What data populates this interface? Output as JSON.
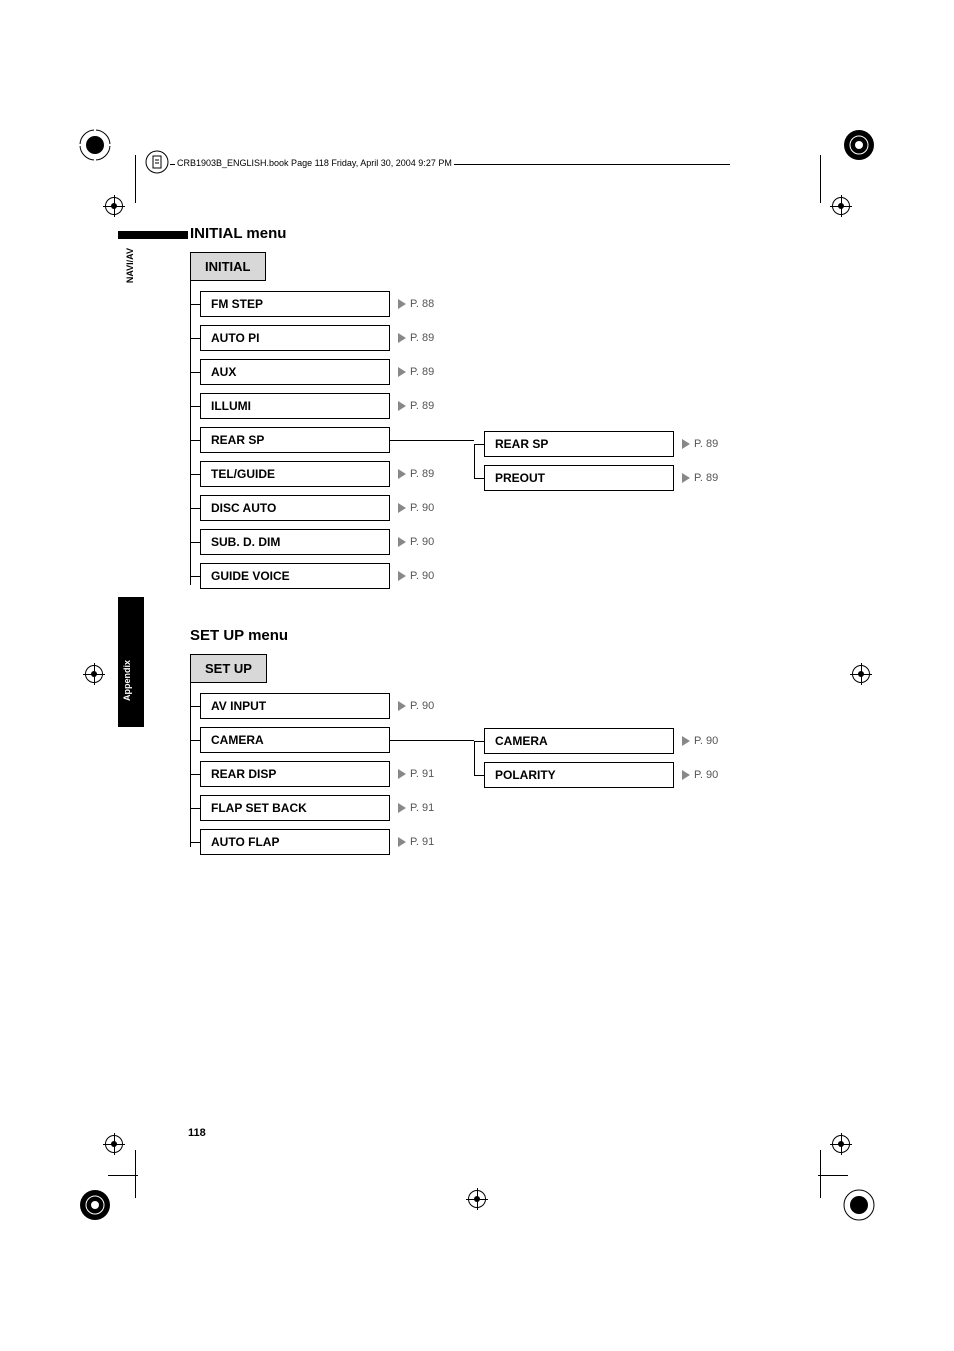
{
  "header": {
    "filename_line": "CRB1903B_ENGLISH.book  Page 118  Friday, April 30, 2004  9:27 PM"
  },
  "sidebar": {
    "tab1": "NAVI/AV",
    "tab2": "Appendix"
  },
  "section1": {
    "title": "INITIAL menu",
    "header": "INITIAL",
    "items": [
      {
        "label": "FM STEP",
        "page": "P. 88"
      },
      {
        "label": "AUTO PI",
        "page": "P. 89"
      },
      {
        "label": "AUX",
        "page": "P. 89"
      },
      {
        "label": "ILLUMI",
        "page": "P. 89"
      },
      {
        "label": "REAR SP",
        "page": ""
      },
      {
        "label": "TEL/GUIDE",
        "page": "P. 89"
      },
      {
        "label": "DISC AUTO",
        "page": "P. 90"
      },
      {
        "label": "SUB. D. DIM",
        "page": "P. 90"
      },
      {
        "label": "GUIDE VOICE",
        "page": "P. 90"
      }
    ],
    "sub": [
      {
        "label": "REAR SP",
        "page": "P. 89"
      },
      {
        "label": "PREOUT",
        "page": "P. 89"
      }
    ]
  },
  "section2": {
    "title": "SET UP menu",
    "header": "SET UP",
    "items": [
      {
        "label": "AV INPUT",
        "page": "P. 90"
      },
      {
        "label": "CAMERA",
        "page": ""
      },
      {
        "label": "REAR DISP",
        "page": "P. 91"
      },
      {
        "label": "FLAP SET BACK",
        "page": "P. 91"
      },
      {
        "label": "AUTO FLAP",
        "page": "P. 91"
      }
    ],
    "sub": [
      {
        "label": "CAMERA",
        "page": "P. 90"
      },
      {
        "label": "POLARITY",
        "page": "P. 90"
      }
    ]
  },
  "page_number": "118"
}
